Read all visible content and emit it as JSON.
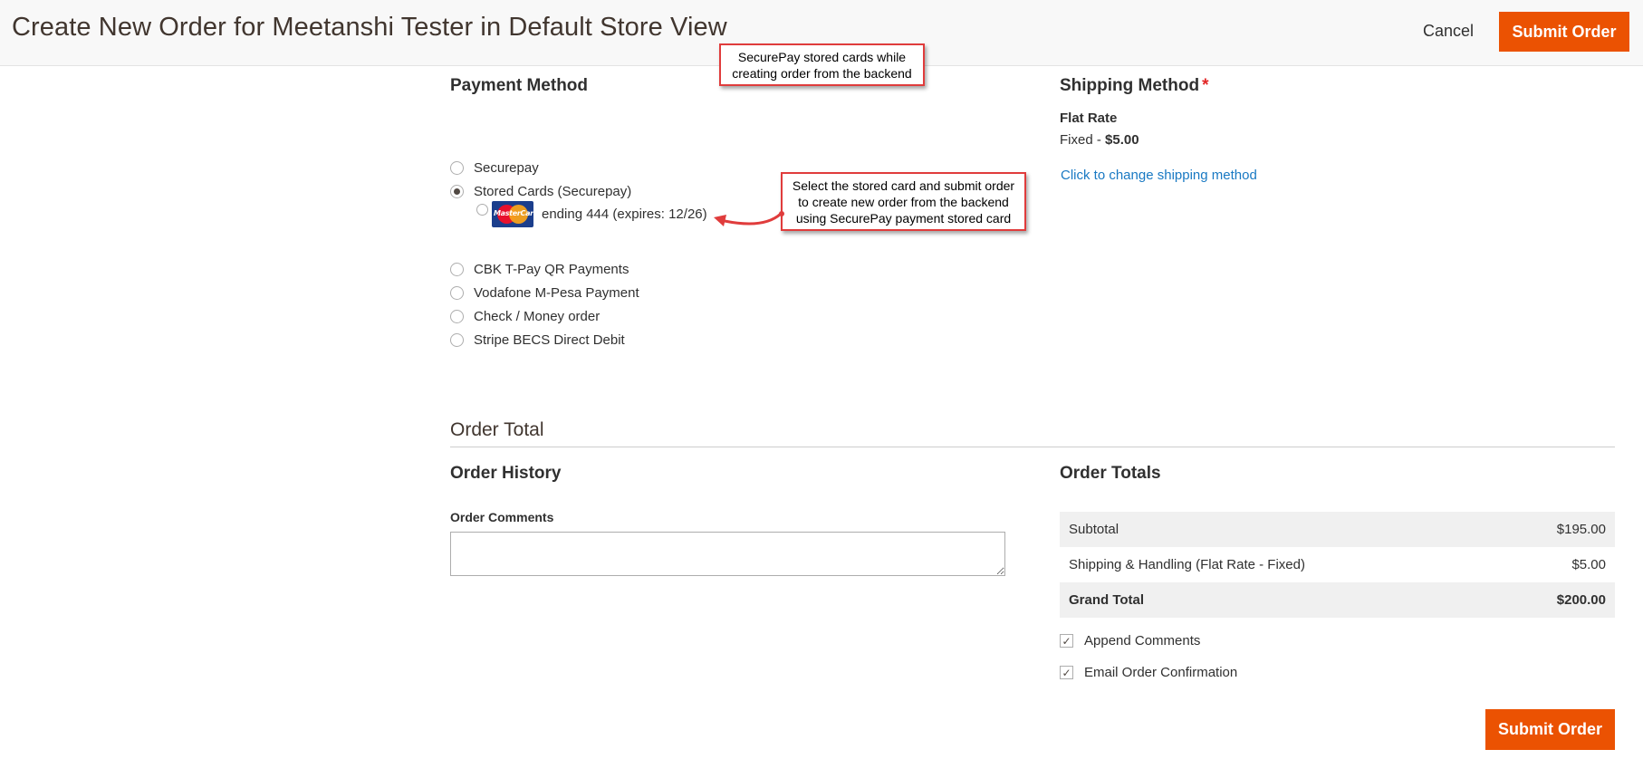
{
  "header": {
    "title": "Create New Order for Meetanshi Tester in Default Store View",
    "cancel_label": "Cancel",
    "submit_label": "Submit Order"
  },
  "payment": {
    "title": "Payment Method",
    "options": [
      {
        "label": "Securepay",
        "selected": false
      },
      {
        "label": "Stored Cards (Securepay)",
        "selected": true
      },
      {
        "label": "CBK T-Pay QR Payments",
        "selected": false
      },
      {
        "label": "Vodafone M-Pesa Payment",
        "selected": false
      },
      {
        "label": "Check / Money order",
        "selected": false
      },
      {
        "label": "Stripe BECS Direct Debit",
        "selected": false
      }
    ],
    "stored_card": {
      "brand_logo_text": "MasterCard",
      "label": "ending 444 (expires: 12/26)",
      "selected": false
    }
  },
  "callouts": {
    "top": "SecurePay stored cards while creating order from the backend",
    "side": "Select the stored card and submit order to create new order from the backend using SecurePay payment stored card"
  },
  "shipping": {
    "title": "Shipping Method",
    "required_mark": "*",
    "carrier": "Flat Rate",
    "method_prefix": "Fixed - ",
    "price": "$5.00",
    "change_link": "Click to change shipping method"
  },
  "order_total": {
    "title": "Order Total"
  },
  "history": {
    "title": "Order History",
    "comments_label": "Order Comments",
    "comments_value": ""
  },
  "totals": {
    "title": "Order Totals",
    "rows": [
      {
        "label": "Subtotal",
        "value": "$195.00"
      },
      {
        "label": "Shipping & Handling (Flat Rate - Fixed)",
        "value": "$5.00"
      },
      {
        "label": "Grand Total",
        "value": "$200.00"
      }
    ],
    "append_comments": {
      "label": "Append Comments",
      "checked": true
    },
    "email_confirmation": {
      "label": "Email Order Confirmation",
      "checked": true
    },
    "submit_label": "Submit Order"
  },
  "colors": {
    "accent": "#eb5202",
    "link": "#1979c3",
    "callout_border": "#e03c3c",
    "required": "#e22626"
  },
  "icons": {
    "checkmark": "✓"
  }
}
